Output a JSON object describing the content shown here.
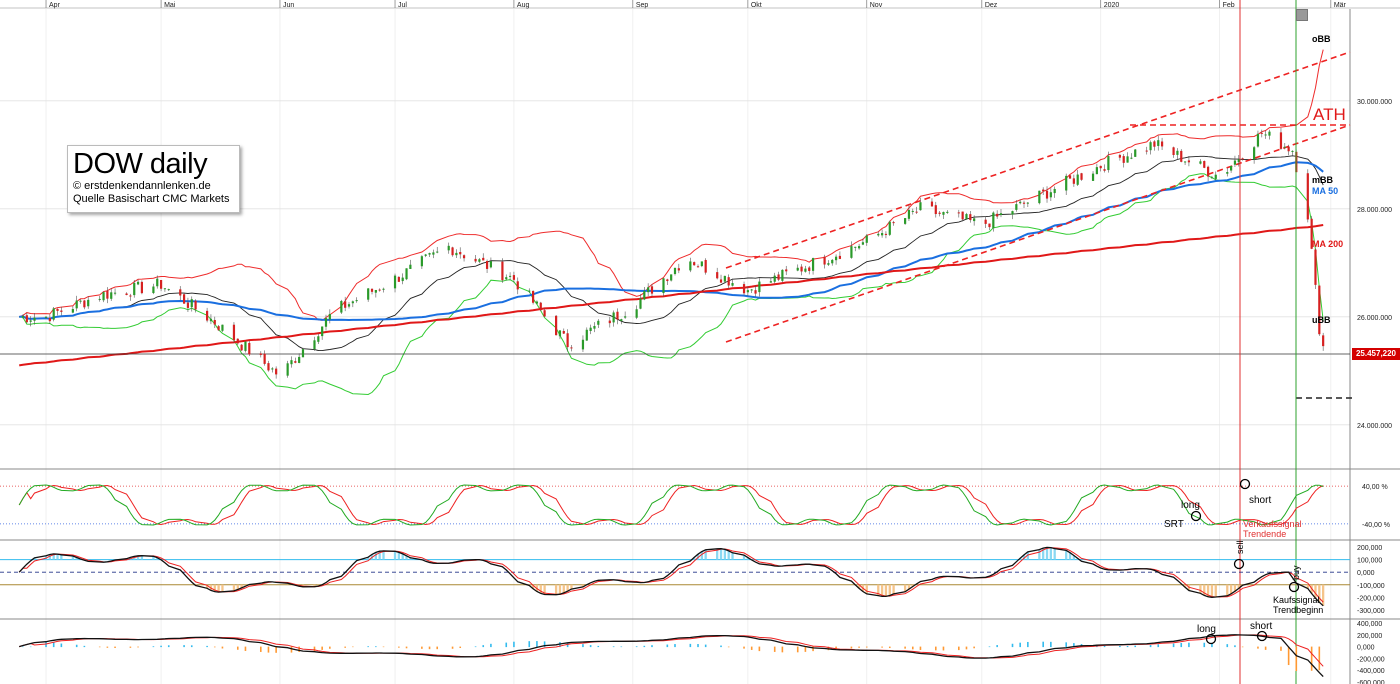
{
  "info_box": {
    "title": "DOW daily",
    "line1": "© erstdenkendannlenken.de",
    "line2": "Quelle Basischart CMC Markets"
  },
  "last_price_label": "25.457,220",
  "colors": {
    "price_up": "#2a9a2a",
    "price_down": "#d62020",
    "bollinger_band": "#ee2b2b",
    "bollinger_lower": "#33cc33",
    "mid_band": "#222222",
    "ma50": "#1a6fe0",
    "ma200": "#e01818",
    "trendline": "#ee2222",
    "osc_fast": "#22aa22",
    "osc_slow": "#ee2222",
    "macd_line": "#111111",
    "macd_signal": "#ee2222",
    "hist_pos": "#33bbee",
    "hist_neg": "#ff9933"
  },
  "chart_data": {
    "type": "line",
    "title": "DOW daily",
    "x_axis": {
      "month_labels": [
        "Apr",
        "Mai",
        "Jun",
        "Jul",
        "Aug",
        "Sep",
        "Okt",
        "Nov",
        "Dez",
        "2020",
        "Feb",
        "Mär"
      ]
    },
    "y_axis": {
      "range": [
        23200000,
        31700000
      ],
      "tick_labels": [
        "30.000.000",
        "28.000.000",
        "26.000.000",
        "24.000.000"
      ],
      "tick_values": [
        30000000,
        28000000,
        26000000,
        24000000
      ]
    },
    "last_price": 25457220,
    "price_series": [
      {
        "date": "2019-04-01",
        "value": 26000000
      },
      {
        "date": "2019-04-15",
        "value": 26400000
      },
      {
        "date": "2019-05-01",
        "value": 26600000
      },
      {
        "date": "2019-05-15",
        "value": 25900000
      },
      {
        "date": "2019-06-01",
        "value": 24900000
      },
      {
        "date": "2019-06-15",
        "value": 26100000
      },
      {
        "date": "2019-07-01",
        "value": 26700000
      },
      {
        "date": "2019-07-15",
        "value": 27300000
      },
      {
        "date": "2019-08-01",
        "value": 26700000
      },
      {
        "date": "2019-08-15",
        "value": 25500000
      },
      {
        "date": "2019-09-01",
        "value": 26200000
      },
      {
        "date": "2019-09-15",
        "value": 27100000
      },
      {
        "date": "2019-10-01",
        "value": 26500000
      },
      {
        "date": "2019-10-15",
        "value": 26900000
      },
      {
        "date": "2019-11-01",
        "value": 27400000
      },
      {
        "date": "2019-11-15",
        "value": 28000000
      },
      {
        "date": "2019-12-01",
        "value": 27700000
      },
      {
        "date": "2019-12-15",
        "value": 28200000
      },
      {
        "date": "2020-01-01",
        "value": 28800000
      },
      {
        "date": "2020-01-15",
        "value": 29200000
      },
      {
        "date": "2020-02-01",
        "value": 28600000
      },
      {
        "date": "2020-02-12",
        "value": 29400000
      },
      {
        "date": "2020-02-20",
        "value": 29100000
      },
      {
        "date": "2020-02-24",
        "value": 27900000
      },
      {
        "date": "2020-02-27",
        "value": 25800000
      },
      {
        "date": "2020-02-28",
        "value": 25457220
      }
    ],
    "series": [
      {
        "name": "oBB",
        "label_color": "#000000"
      },
      {
        "name": "mBB",
        "label_color": "#000000"
      },
      {
        "name": "MA 50",
        "label_color": "#1a6fe0"
      },
      {
        "name": "MA 200",
        "label_color": "#e01818"
      },
      {
        "name": "uBB",
        "label_color": "#000000"
      }
    ],
    "annotations": {
      "ath": "ATH"
    },
    "oscillator": {
      "tick_labels": [
        "40,00 %",
        "-40,00 %"
      ],
      "tick_values": [
        40,
        -40
      ],
      "signals": [
        {
          "text": "short"
        },
        {
          "text": "long"
        },
        {
          "text": "SRT"
        },
        {
          "text": "Verkaufssignal"
        },
        {
          "text": "Trendende"
        }
      ]
    },
    "macd": {
      "tick_labels": [
        "200,000",
        "100,000",
        "0,000",
        "-100,000",
        "-200,000",
        "-300,000"
      ],
      "tick_values": [
        200000,
        100000,
        0,
        -100000,
        -200000,
        -300000
      ],
      "signals": [
        {
          "text": "sell"
        },
        {
          "text": "buy"
        },
        {
          "text": "Kaufssignal"
        },
        {
          "text": "Trendbeginn"
        }
      ]
    },
    "histogram": {
      "tick_labels": [
        "400,000",
        "200,000",
        "0,000",
        "-200,000",
        "-400,000",
        "-600,000"
      ],
      "tick_values": [
        400000,
        200000,
        0,
        -200000,
        -400000,
        -600000
      ],
      "signals": [
        {
          "text": "long"
        },
        {
          "text": "short"
        }
      ]
    }
  }
}
